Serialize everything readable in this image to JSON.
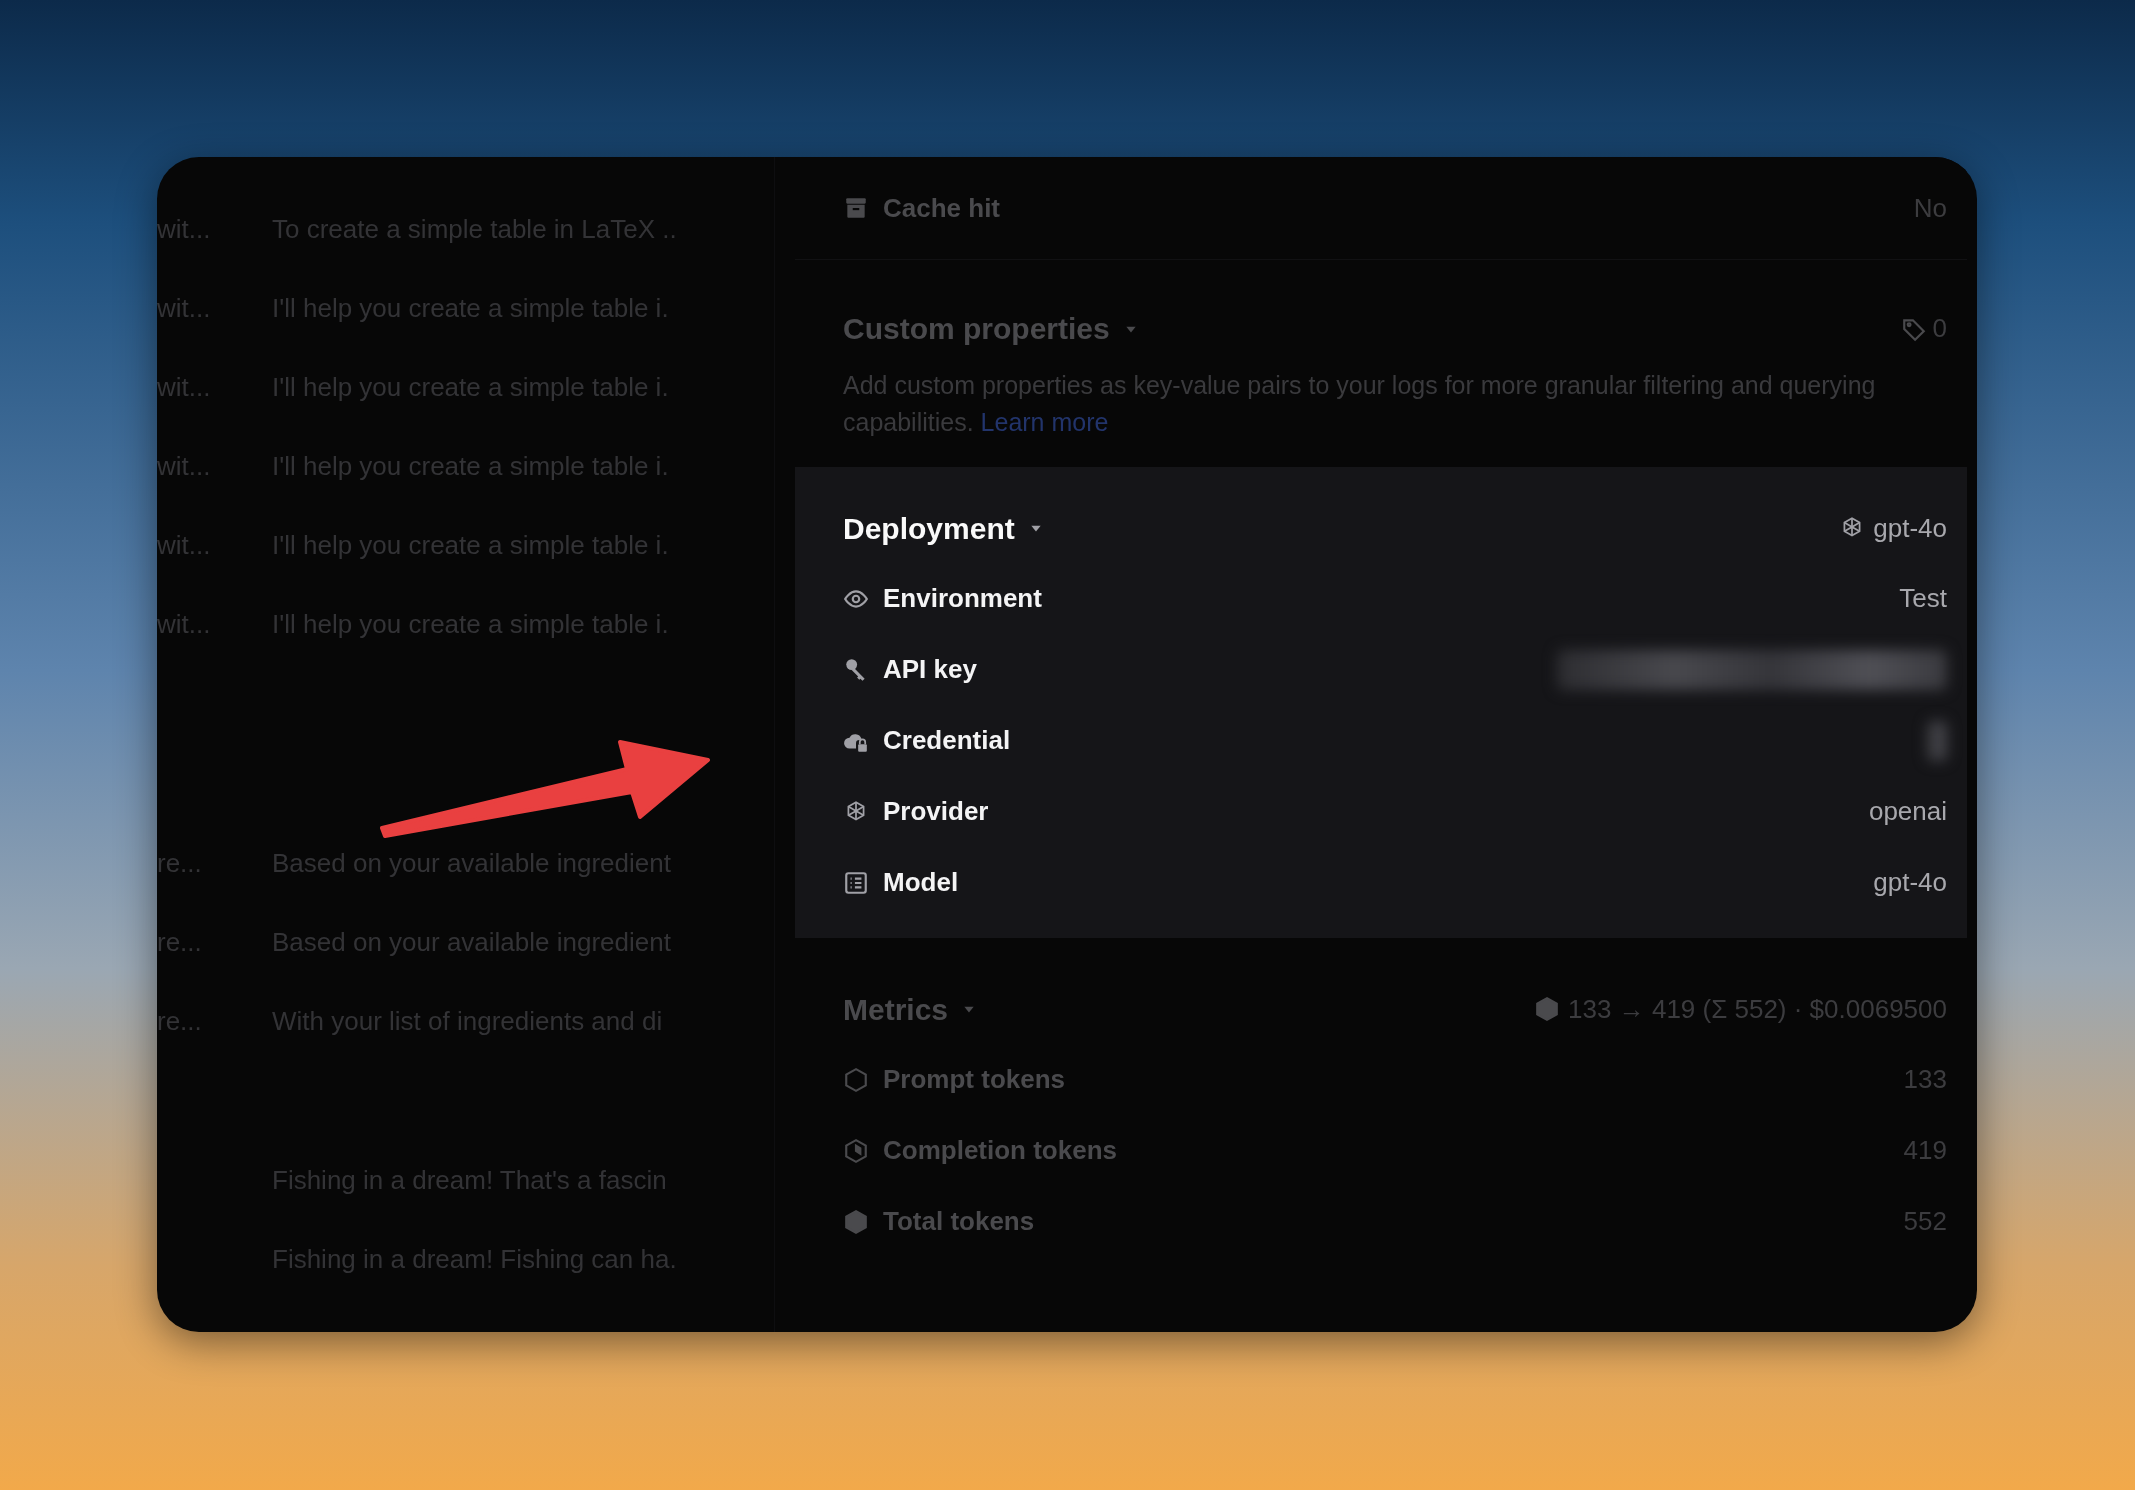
{
  "log_list": {
    "groups": [
      {
        "rows": [
          {
            "input": "wit...",
            "output": "To create a simple table in LaTeX .."
          },
          {
            "input": "wit...",
            "output": "I'll help you create a simple table i."
          },
          {
            "input": "wit...",
            "output": "I'll help you create a simple table i."
          },
          {
            "input": "wit...",
            "output": "I'll help you create a simple table i."
          },
          {
            "input": "wit...",
            "output": "I'll help you create a simple table i."
          },
          {
            "input": "wit...",
            "output": "I'll help you create a simple table i."
          }
        ]
      },
      {
        "rows": [
          {
            "input": "re...",
            "output": "Based on your available ingredient"
          },
          {
            "input": "re...",
            "output": "Based on your available ingredient"
          },
          {
            "input": "re...",
            "output": "With your list of ingredients and di"
          }
        ]
      },
      {
        "rows": [
          {
            "output": "Fishing in a dream! That's a fascin"
          },
          {
            "output": "Fishing in a dream! Fishing can ha."
          }
        ]
      }
    ]
  },
  "cache_hit": {
    "label": "Cache hit",
    "value": "No",
    "highlighted": false
  },
  "custom_properties": {
    "title": "Custom properties",
    "count": "0",
    "description": "Add custom properties as key-value pairs to your logs for more granular filtering and querying capabilities.",
    "link": "Learn more",
    "highlighted": false
  },
  "deployment": {
    "title": "Deployment",
    "summary": "gpt-4o",
    "highlighted": true,
    "rows": [
      {
        "label": "Environment",
        "value": "Test"
      },
      {
        "label": "API key",
        "redacted": true
      },
      {
        "label": "Credential",
        "redacted": true
      },
      {
        "label": "Provider",
        "value": "openai"
      },
      {
        "label": "Model",
        "value": "gpt-4o"
      }
    ]
  },
  "metrics": {
    "title": "Metrics",
    "summary": "133 → 419 (Σ 552) · $0.0069500",
    "highlighted": false,
    "rows": [
      {
        "label": "Prompt tokens",
        "value": "133"
      },
      {
        "label": "Completion tokens",
        "value": "419"
      },
      {
        "label": "Total tokens",
        "value": "552"
      }
    ]
  }
}
